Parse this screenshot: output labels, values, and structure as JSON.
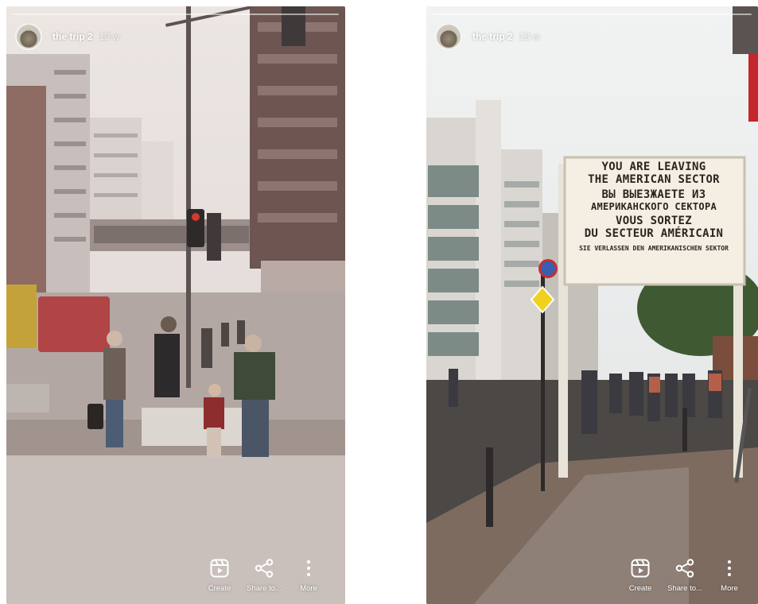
{
  "stories": [
    {
      "username": "the trip 2",
      "time_ago": "13 w",
      "actions": [
        {
          "label": "Create",
          "icon": "reel-icon"
        },
        {
          "label": "Share to...",
          "icon": "share-icon"
        },
        {
          "label": "More",
          "icon": "more-vertical-icon"
        }
      ]
    },
    {
      "username": "the trip 2",
      "time_ago": "13 w",
      "sign": {
        "line1": "YOU ARE LEAVING",
        "line2": "THE AMERICAN SECTOR",
        "line3": "ВЫ ВЫЕЗЖАЕТЕ ИЗ",
        "line4": "АМЕРИКАНСКОГО СЕКТОРА",
        "line5": "VOUS SORTEZ",
        "line6": "DU SECTEUR AMÉRICAIN",
        "line7": "SIE VERLASSEN DEN AMERIKANISCHEN SEKTOR"
      },
      "actions": [
        {
          "label": "Create",
          "icon": "reel-icon"
        },
        {
          "label": "Share to...",
          "icon": "share-icon"
        },
        {
          "label": "More",
          "icon": "more-vertical-icon"
        }
      ]
    }
  ]
}
